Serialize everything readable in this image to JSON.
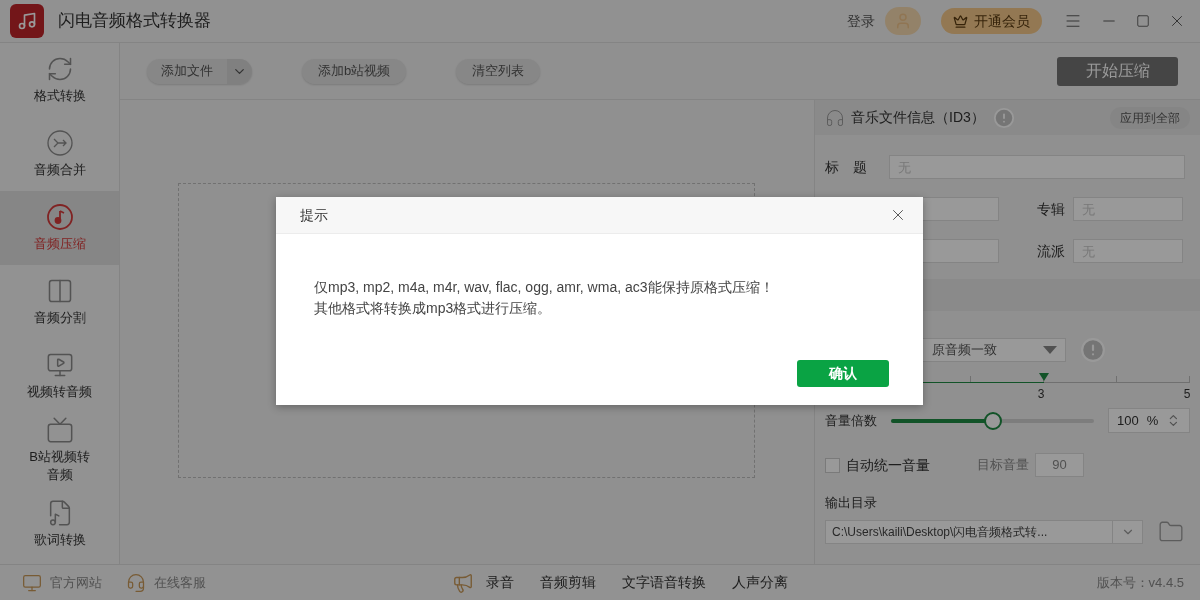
{
  "window": {
    "title": "闪电音频格式转换器",
    "login": "登录",
    "vip_button": "开通会员"
  },
  "sidebar": {
    "items": [
      {
        "label": "格式转换",
        "kind": "convert",
        "selected": false
      },
      {
        "label": "音频合并",
        "kind": "merge",
        "selected": false
      },
      {
        "label": "音频压缩",
        "kind": "compress",
        "selected": true
      },
      {
        "label": "音频分割",
        "kind": "split",
        "selected": false
      },
      {
        "label": "视频转音频",
        "kind": "video",
        "selected": false
      },
      {
        "label": "B站视频转音频",
        "kind": "bilibili",
        "selected": false
      },
      {
        "label": "歌词转换",
        "kind": "lyrics",
        "selected": false
      }
    ]
  },
  "toolbar": {
    "buttons": [
      {
        "label": "添加文件",
        "kind": "dropdown"
      },
      {
        "label": "添加b站视频",
        "kind": "plain"
      },
      {
        "label": "清空列表",
        "kind": "plain"
      }
    ],
    "start_button": "开始压缩"
  },
  "id3_panel": {
    "title": "音乐文件信息（ID3）",
    "apply_all": "应用到全部",
    "title_field": {
      "label": "标　题",
      "placeholder": "无"
    },
    "album_field": {
      "label": "专辑",
      "placeholder": "无"
    },
    "genre_field": {
      "label": "流派",
      "placeholder": "无"
    }
  },
  "compression": {
    "quality_select": "原音频一致",
    "level": 0.6,
    "tick_labels": [
      {
        "label": "3",
        "level": 0.6
      },
      {
        "label": "5",
        "level": 1
      }
    ]
  },
  "volume": {
    "label": "音量倍数",
    "level": 0.5,
    "value": "100",
    "unit": "%"
  },
  "auto_volume": {
    "label": "自动统一音量",
    "checked": false,
    "target_label": "目标音量",
    "target_value": "90"
  },
  "output": {
    "label": "输出目录",
    "path": "C:\\Users\\kaili\\Desktop\\闪电音频格式转..."
  },
  "status_bar": {
    "links": [
      {
        "label": "官方网站",
        "kind": "web"
      },
      {
        "label": "在线客服",
        "kind": "support"
      }
    ],
    "tools": [
      "录音",
      "音频剪辑",
      "文字语音转换",
      "人声分离"
    ],
    "version": "版本号：v4.4.5"
  },
  "dialog": {
    "title": "提示",
    "lines": [
      "仅mp3, mp2, m4a, m4r, wav, flac, ogg, amr, wma, ac3能保持原格式压缩！",
      "其他格式将转换成mp3格式进行压缩。"
    ],
    "confirm": "确认"
  }
}
